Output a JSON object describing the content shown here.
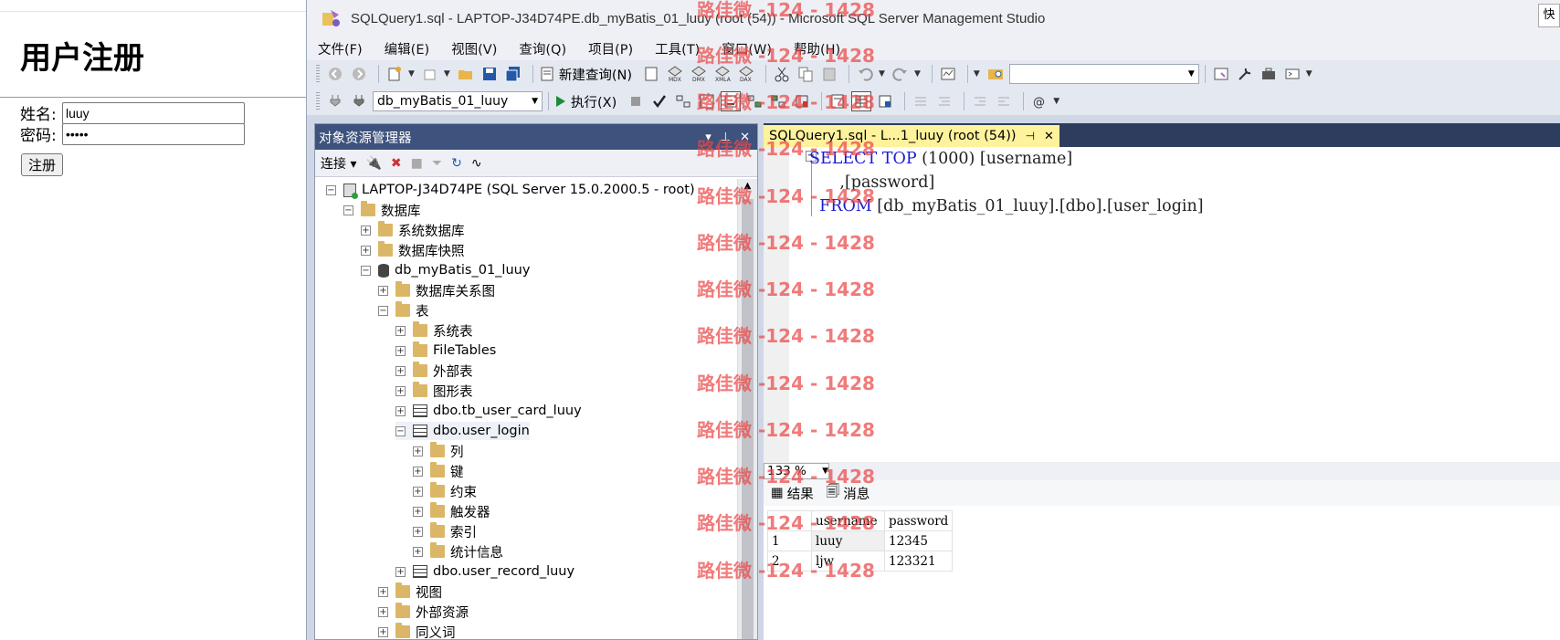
{
  "web_page": {
    "heading": "用户注册",
    "name_label": "姓名:",
    "name_value": "luuy",
    "password_label": "密码:",
    "password_value": "12345",
    "submit_label": "注册"
  },
  "ssms": {
    "window_title": "SQLQuery1.sql - LAPTOP-J34D74PE.db_myBatis_01_luuy (root (54)) - Microsoft SQL Server Management Studio",
    "quick_launch_text": "快",
    "menu": [
      "文件(F)",
      "编辑(E)",
      "视图(V)",
      "查询(Q)",
      "项目(P)",
      "工具(T)",
      "窗口(W)",
      "帮助(H)"
    ],
    "toolbar1": {
      "new_query_label": "新建查询(N)"
    },
    "toolbar2": {
      "database_selected": "db_myBatis_01_luuy",
      "execute_label": "执行(X)"
    },
    "object_explorer": {
      "title": "对象资源管理器",
      "connect_label": "连接",
      "tree": [
        {
          "label": "LAPTOP-J34D74PE (SQL Server 15.0.2000.5 - root)",
          "level": 0,
          "state": "-",
          "icon": "server-icon"
        },
        {
          "label": "数据库",
          "level": 1,
          "state": "-",
          "icon": "folder-icon"
        },
        {
          "label": "系统数据库",
          "level": 2,
          "state": "+",
          "icon": "folder-icon"
        },
        {
          "label": "数据库快照",
          "level": 2,
          "state": "+",
          "icon": "folder-icon"
        },
        {
          "label": "db_myBatis_01_luuy",
          "level": 2,
          "state": "-",
          "icon": "database-icon"
        },
        {
          "label": "数据库关系图",
          "level": 3,
          "state": "+",
          "icon": "folder-icon"
        },
        {
          "label": "表",
          "level": 3,
          "state": "-",
          "icon": "folder-icon"
        },
        {
          "label": "系统表",
          "level": 4,
          "state": "+",
          "icon": "folder-icon"
        },
        {
          "label": "FileTables",
          "level": 4,
          "state": "+",
          "icon": "folder-icon"
        },
        {
          "label": "外部表",
          "level": 4,
          "state": "+",
          "icon": "folder-icon"
        },
        {
          "label": "图形表",
          "level": 4,
          "state": "+",
          "icon": "folder-icon"
        },
        {
          "label": "dbo.tb_user_card_luuy",
          "level": 4,
          "state": "+",
          "icon": "table-icon"
        },
        {
          "label": "dbo.user_login",
          "level": 4,
          "state": "-",
          "icon": "table-icon",
          "selected": true
        },
        {
          "label": "列",
          "level": 5,
          "state": "+",
          "icon": "folder-icon"
        },
        {
          "label": "键",
          "level": 5,
          "state": "+",
          "icon": "folder-icon"
        },
        {
          "label": "约束",
          "level": 5,
          "state": "+",
          "icon": "folder-icon"
        },
        {
          "label": "触发器",
          "level": 5,
          "state": "+",
          "icon": "folder-icon"
        },
        {
          "label": "索引",
          "level": 5,
          "state": "+",
          "icon": "folder-icon"
        },
        {
          "label": "统计信息",
          "level": 5,
          "state": "+",
          "icon": "folder-icon"
        },
        {
          "label": "dbo.user_record_luuy",
          "level": 4,
          "state": "+",
          "icon": "table-icon"
        },
        {
          "label": "视图",
          "level": 3,
          "state": "+",
          "icon": "folder-icon"
        },
        {
          "label": "外部资源",
          "level": 3,
          "state": "+",
          "icon": "folder-icon"
        },
        {
          "label": "同义词",
          "level": 3,
          "state": "+",
          "icon": "folder-icon"
        }
      ]
    },
    "editor": {
      "tab_label": "SQLQuery1.sql - L...1_luuy (root (54))",
      "line1": {
        "kw1": "SELECT",
        "kw2": "TOP",
        "rest": " (1000) [username]"
      },
      "line2": "      ,[password]",
      "line3": {
        "kw": "FROM",
        "rest": " [db_myBatis_01_luuy].[dbo].[user_login]"
      },
      "zoom": "133 %"
    },
    "results": {
      "tab_results": "结果",
      "tab_messages": "消息",
      "columns": [
        "username",
        "password"
      ],
      "rows": [
        {
          "num": "1",
          "username": "luuy",
          "password": "12345"
        },
        {
          "num": "2",
          "username": "ljw",
          "password": "123321"
        }
      ]
    }
  },
  "watermark": "路佳微 -124 - 1428",
  "colors": {
    "oe_title_bg": "#3d527d",
    "doc_tab_bg": "#fff29d",
    "keyword": "#1a1ad6",
    "watermark": "#eb4646"
  }
}
